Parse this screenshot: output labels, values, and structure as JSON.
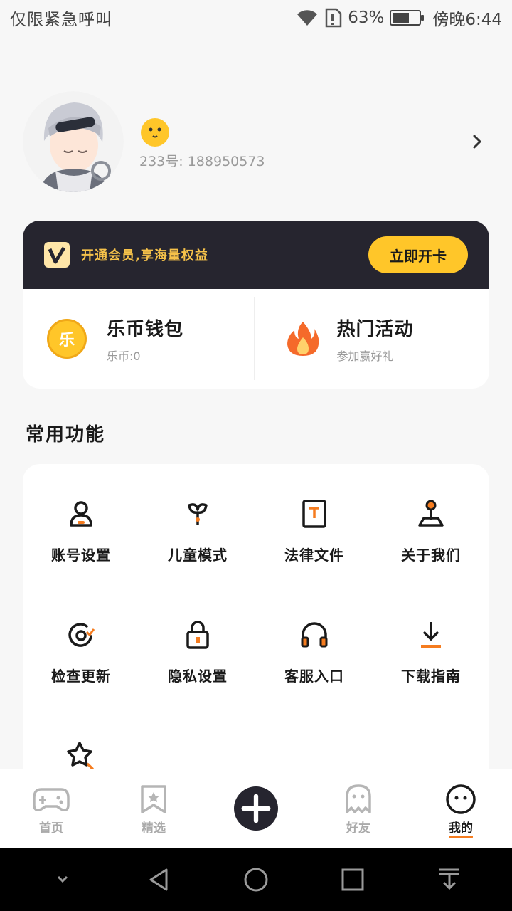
{
  "status_bar": {
    "carrier": "仅限紧急呼叫",
    "battery_percent": "63%",
    "battery_level": 0.63,
    "time": "傍晚6:44"
  },
  "profile": {
    "uid_label": "233号",
    "uid_value": "188950573"
  },
  "vip": {
    "promo_text": "开通会员,享海量权益",
    "button_label": "立即开卡"
  },
  "wallet": {
    "title": "乐币钱包",
    "coin_glyph": "乐",
    "balance_label": "乐币:0"
  },
  "activity": {
    "title": "热门活动",
    "subtitle": "参加赢好礼"
  },
  "common_functions": {
    "title": "常用功能",
    "items": [
      {
        "label": "账号设置",
        "icon": "account-icon"
      },
      {
        "label": "儿童模式",
        "icon": "sprout-icon"
      },
      {
        "label": "法律文件",
        "icon": "document-icon"
      },
      {
        "label": "关于我们",
        "icon": "joystick-icon"
      },
      {
        "label": "检查更新",
        "icon": "refresh-icon"
      },
      {
        "label": "隐私设置",
        "icon": "lock-icon"
      },
      {
        "label": "客服入口",
        "icon": "headphones-icon"
      },
      {
        "label": "下载指南",
        "icon": "download-icon"
      },
      {
        "label": "",
        "icon": "star-search-icon"
      }
    ]
  },
  "tabs": [
    {
      "label": "首页",
      "icon": "gamepad-icon",
      "active": false
    },
    {
      "label": "精选",
      "icon": "bookmark-star-icon",
      "active": false
    },
    {
      "label": "",
      "icon": "add-icon",
      "active": false
    },
    {
      "label": "好友",
      "icon": "ghost-icon",
      "active": false
    },
    {
      "label": "我的",
      "icon": "smiley-icon",
      "active": true
    }
  ],
  "colors": {
    "accent": "#ffc629",
    "dark": "#26252f",
    "orange": "#f57c1f",
    "vip_text": "#f6c24a"
  }
}
